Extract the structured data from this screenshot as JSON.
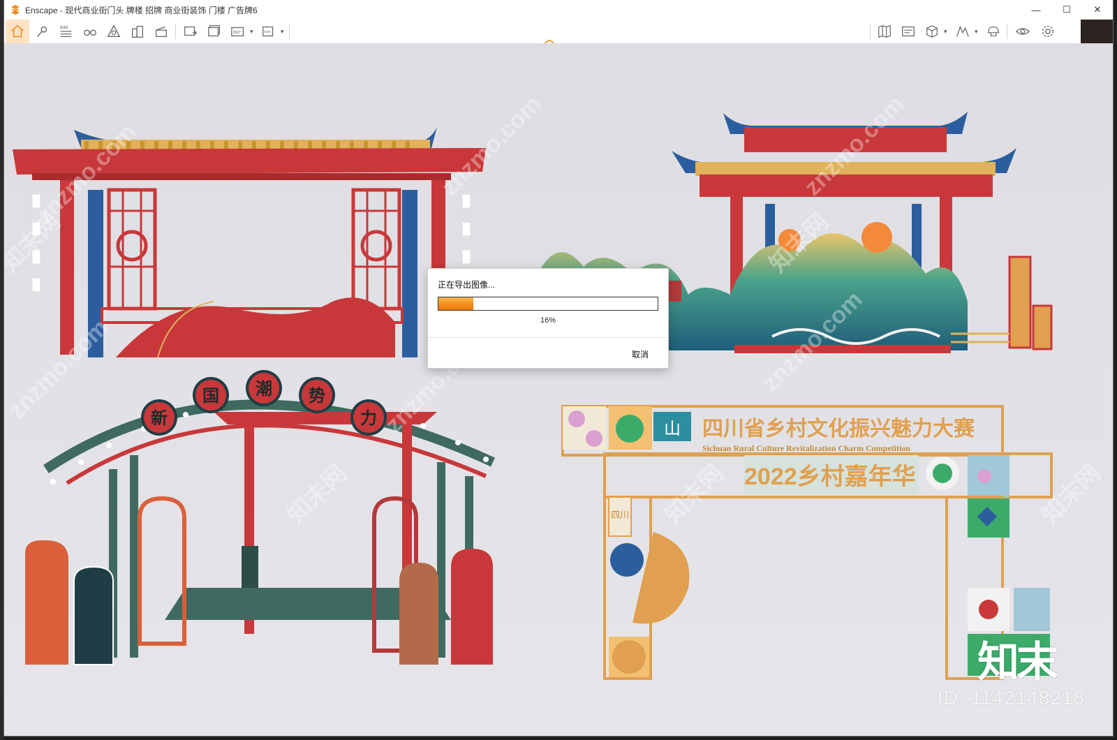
{
  "window": {
    "title": "Enscape - 现代商业街门头 牌楼 招牌 商业街装饰 门楼 广告牌6",
    "controls": {
      "minimize": "—",
      "maximize": "☐",
      "close": "✕"
    }
  },
  "toolbar": {
    "left_tools": [
      {
        "icon": "home-icon"
      },
      {
        "icon": "location-pin-icon"
      },
      {
        "icon": "bim-icon",
        "label": "BIM"
      },
      {
        "icon": "binoculars-icon"
      },
      {
        "icon": "asset-library-icon"
      },
      {
        "icon": "buildings-icon"
      },
      {
        "icon": "clapperboard-icon"
      },
      {
        "icon": "render-image-icon"
      },
      {
        "icon": "batch-render-icon"
      },
      {
        "icon": "panorama-360-icon",
        "label": "360°"
      },
      {
        "icon": "export-exe-icon",
        "label": "EXE"
      }
    ],
    "right_tools": [
      {
        "icon": "map-icon"
      },
      {
        "icon": "display-settings-icon"
      },
      {
        "icon": "cube-icon"
      },
      {
        "icon": "terrain-icon"
      },
      {
        "icon": "cap-icon"
      },
      {
        "icon": "eye-icon"
      },
      {
        "icon": "gear-icon"
      }
    ]
  },
  "scene": {
    "sign_title": "四川省乡村文化振兴魅力大赛",
    "sign_subtitle": "Sichuan Rural Culture Revitalization Charm Competition",
    "sign_year_line": "2022乡村嘉年华",
    "sign_vertical": "四川",
    "arch_characters": [
      "新",
      "国",
      "潮",
      "势",
      "力"
    ],
    "watermark_brand": "知末",
    "watermark_id": "ID: 1142148218",
    "watermark_site": "znzmo.com",
    "watermark_cn": "知末网"
  },
  "dialog": {
    "title": "正在导出图像...",
    "progress": 0.16,
    "percent_label": "16%",
    "cancel_label": "取消"
  },
  "colors": {
    "accent": "#f28a1a",
    "chinese_red": "#c8383a",
    "roof_blue": "#2b5e9e",
    "gold": "#e0b25b"
  }
}
